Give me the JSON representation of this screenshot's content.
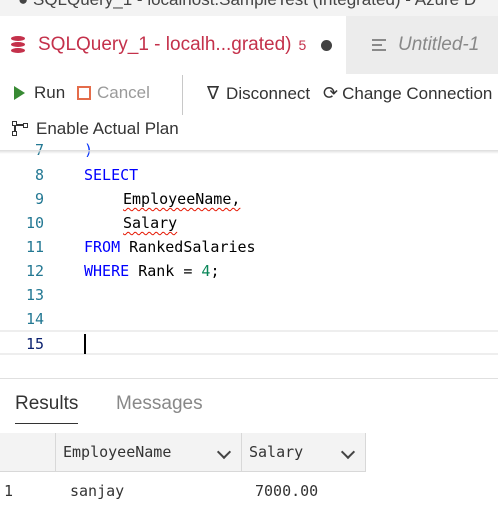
{
  "window": {
    "title": "● SQLQuery_1 - localhost.SampleTest (Integrated) - Azure D"
  },
  "tabs": [
    {
      "label": "SQLQuery_1 - localh...grated)",
      "count": "5",
      "active": true
    },
    {
      "label": "Untitled-1",
      "active": false
    }
  ],
  "toolbar": {
    "run_label": "Run",
    "cancel_label": "Cancel",
    "disconnect_label": "Disconnect",
    "change_connection_label": "Change Connection",
    "actual_plan_label": "Enable Actual Plan"
  },
  "editor": {
    "lines": [
      {
        "num": "7",
        "text": ")"
      },
      {
        "num": "8",
        "text": "SELECT"
      },
      {
        "num": "9",
        "text": "EmployeeName,"
      },
      {
        "num": "10",
        "text": "Salary"
      },
      {
        "num": "11",
        "kw": "FROM",
        "text": "RankedSalaries"
      },
      {
        "num": "12",
        "kw": "WHERE",
        "text": "Rank = ",
        "number": "4",
        "tail": ";"
      },
      {
        "num": "13",
        "text": ""
      },
      {
        "num": "14",
        "text": ""
      },
      {
        "num": "15",
        "text": ""
      }
    ],
    "current_line": "15"
  },
  "results": {
    "tabs": [
      "Results",
      "Messages"
    ],
    "columns": [
      "EmployeeName",
      "Salary"
    ],
    "rows": [
      {
        "row_number": "1",
        "cells": [
          "sanjay",
          "7000.00"
        ]
      }
    ]
  },
  "colors": {
    "accent": "#c4314b",
    "keyword": "#0000ff",
    "line_number": "#237893",
    "run_green": "#388a34",
    "cancel_orange": "#e46c4a"
  }
}
